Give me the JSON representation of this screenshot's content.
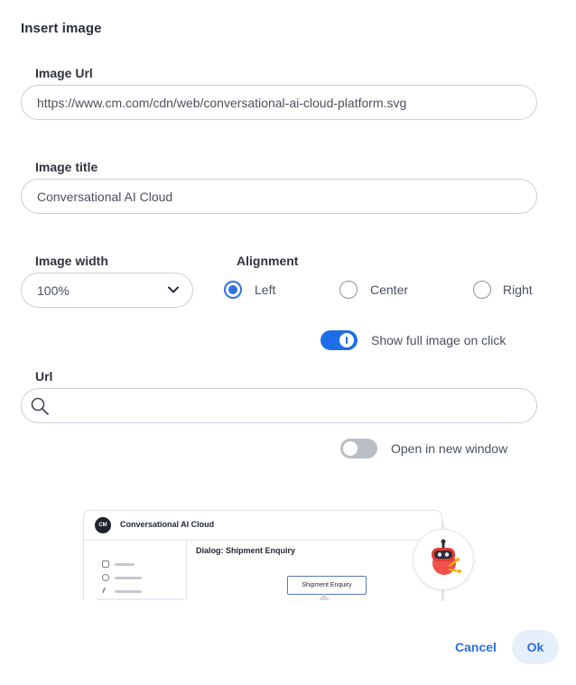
{
  "dialog": {
    "title": "Insert image"
  },
  "image_url": {
    "label": "Image Url",
    "value": "https://www.cm.com/cdn/web/conversational-ai-cloud-platform.svg"
  },
  "image_title": {
    "label": "Image title",
    "value": "Conversational AI Cloud"
  },
  "image_width": {
    "label": "Image width",
    "value": "100%"
  },
  "alignment": {
    "label": "Alignment",
    "options": [
      "Left",
      "Center",
      "Right"
    ],
    "selected": "Left"
  },
  "show_full_image": {
    "label": "Show full image on click",
    "checked": true
  },
  "url": {
    "label": "Url",
    "value": "",
    "placeholder": ""
  },
  "open_new_window": {
    "label": "Open in new window",
    "checked": false
  },
  "preview": {
    "logo_text": "CM",
    "app_name": "Conversational AI Cloud",
    "dialog_title": "Dialog: Shipment Enquiry",
    "node_label": "Shipment Enquiry"
  },
  "buttons": {
    "cancel": "Cancel",
    "ok": "Ok"
  },
  "colors": {
    "accent": "#1d6ee6",
    "toggle_off": "#b9bec6",
    "border": "#c9ced6",
    "ok_bg": "#e6f0fc"
  }
}
